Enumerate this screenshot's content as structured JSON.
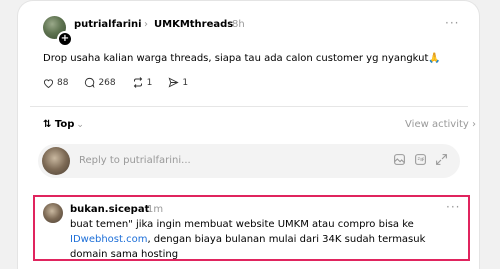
{
  "post": {
    "username": "putrialfarini",
    "separator": "›",
    "community": "UMKMthreads",
    "time": "8h",
    "more": "···",
    "text": "Drop usaha kalian warga threads, siapa tau ada calon customer yg nyangkut🙏",
    "likes": "88",
    "comments": "268",
    "reposts": "1",
    "shares": "1"
  },
  "sort": {
    "label": "Top",
    "icon": "⇅",
    "chevron": "⌄",
    "view_activity": "View activity ›"
  },
  "reply": {
    "placeholder": "Reply to putrialfarini..."
  },
  "comment": {
    "username": "bukan.sicepat",
    "time": "1m",
    "more": "···",
    "text_before_link": "buat temen\" jika ingin membuat website UMKM atau compro bisa ke ",
    "link": "IDwebhost.com",
    "text_after_link": ", dengan biaya bulanan mulai dari 34K sudah termasuk domain sama hosting"
  },
  "colors": {
    "highlight": "#e0245e",
    "link": "#1d6fd8"
  }
}
